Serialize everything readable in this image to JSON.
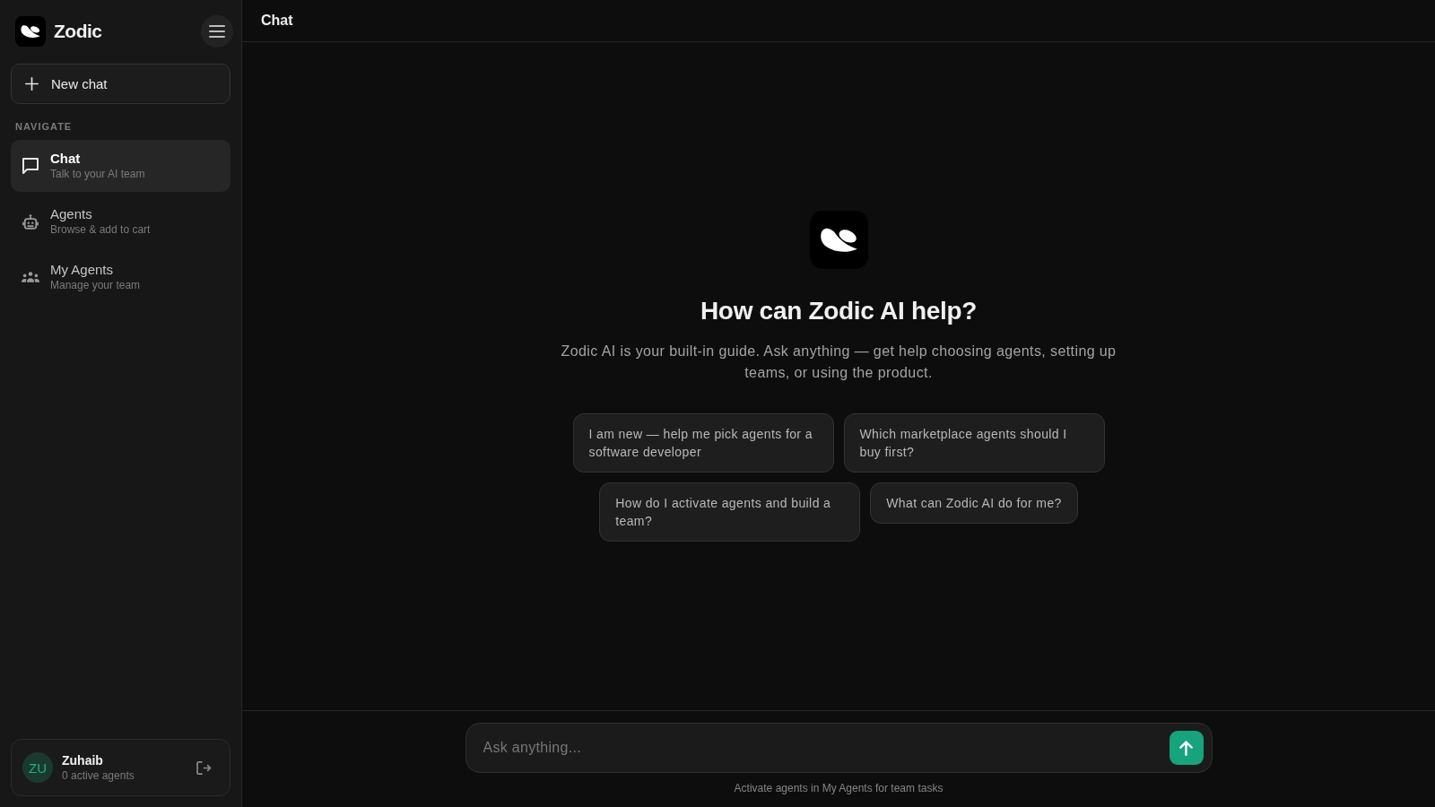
{
  "sidebar": {
    "brand": "Zodic",
    "new_chat": "New chat",
    "section_label": "NAVIGATE",
    "nav_items": [
      {
        "kind": "chat",
        "title": "Chat",
        "subtitle": "Talk to your AI team",
        "selected": true
      },
      {
        "kind": "agents",
        "title": "Agents",
        "subtitle": "Browse & add to cart",
        "selected": false
      },
      {
        "kind": "team",
        "title": "My Agents",
        "subtitle": "Manage your team",
        "selected": false
      }
    ],
    "user": {
      "initials": "ZU",
      "name": "Zuhaib",
      "status": "0 active agents"
    }
  },
  "header": {
    "title": "Chat"
  },
  "hero": {
    "title": "How can Zodic AI help?",
    "description": "Zodic AI is your built-in guide. Ask anything — get help choosing agents, setting up teams, or using the product.",
    "suggestions": [
      "I am new — help me pick agents for a software developer",
      "Which marketplace agents should I buy first?",
      "How do I activate agents and build a team?",
      "What can Zodic AI do for me?"
    ]
  },
  "composer": {
    "placeholder": "Ask anything...",
    "hint": "Activate agents in My Agents for team tasks"
  }
}
